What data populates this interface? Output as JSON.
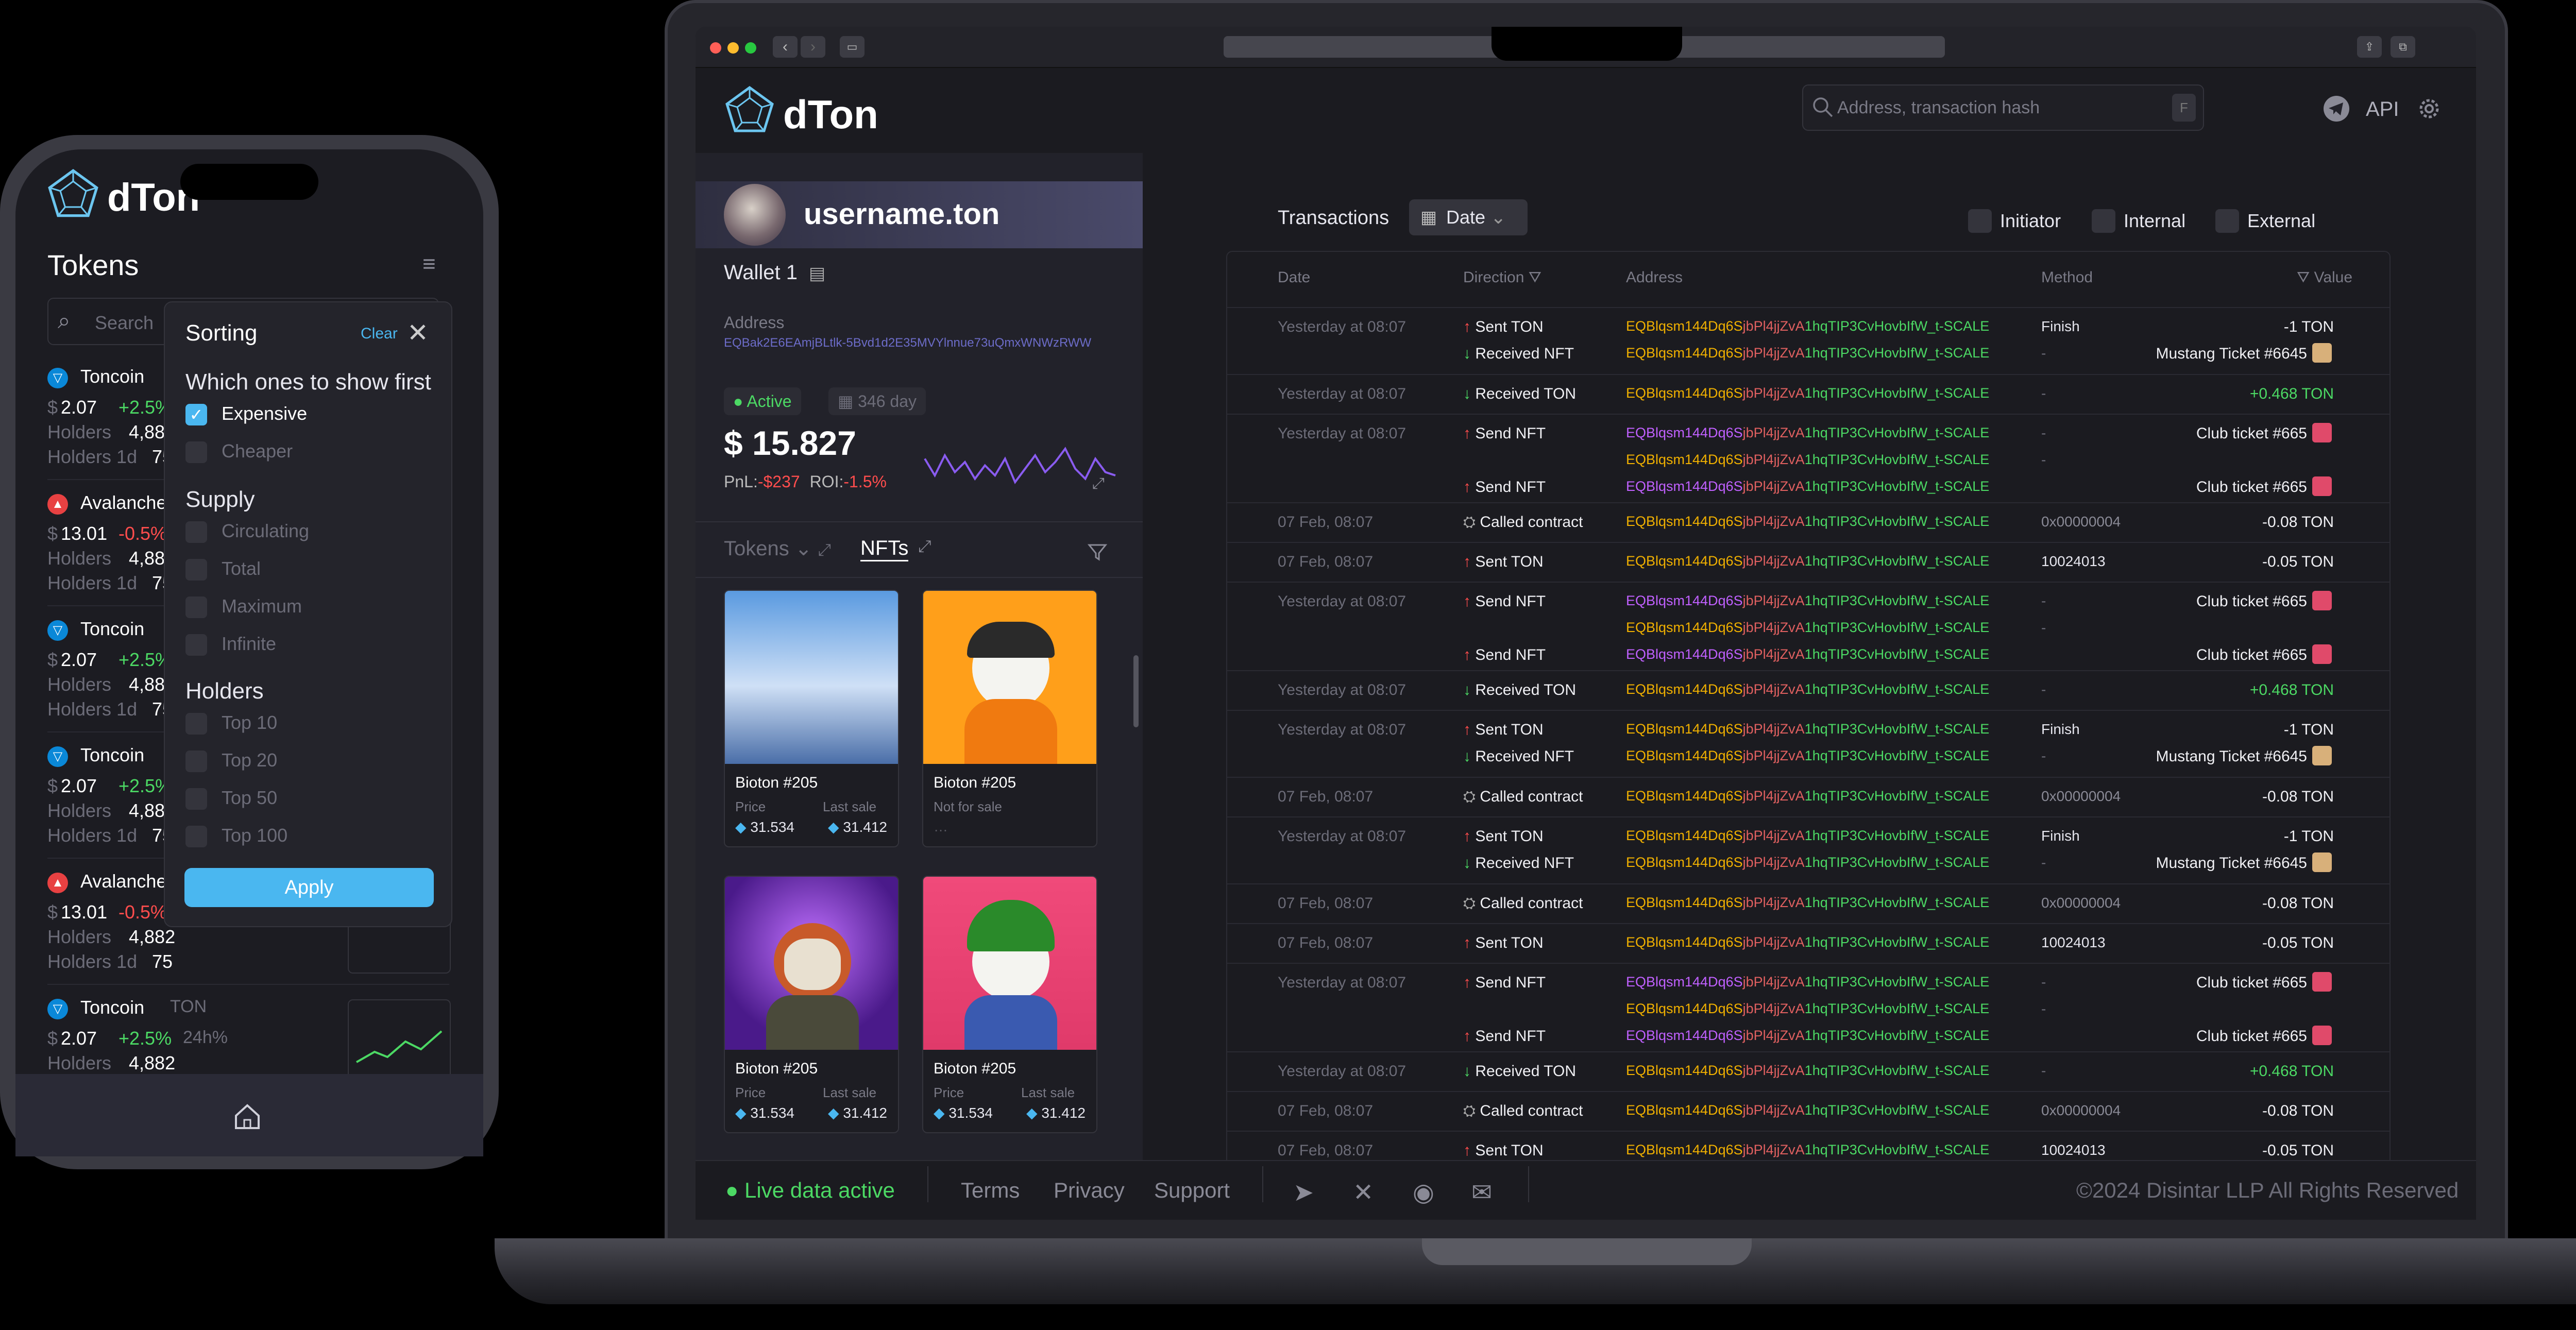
{
  "app": {
    "brand": "dTon"
  },
  "search": {
    "placeholder": "Address, transaction hash",
    "shortcut": "F"
  },
  "header": {
    "api_label": "API"
  },
  "profile": {
    "username": "username.ton",
    "wallet_label": "Wallet 1",
    "address_label": "Address",
    "address_value": "EQBak2E6EAmjBLtlk-5Bvd1d2E35MVYlnnue73uQmxWNWzRWW",
    "status": "Active",
    "age": "346 day",
    "balance": "$ 15.827",
    "pnl_label": "PnL:",
    "pnl_value": "-$237",
    "roi_label": "ROI:",
    "roi_value": "-1.5%",
    "sparkline": [
      0.55,
      0.3,
      0.6,
      0.35,
      0.5,
      0.25,
      0.45,
      0.3,
      0.55,
      0.2,
      0.4,
      0.6,
      0.35,
      0.5,
      0.7,
      0.4,
      0.25,
      0.55,
      0.35,
      0.3
    ]
  },
  "assets_tabs": {
    "tokens": "Tokens",
    "nfts": "NFTs"
  },
  "nfts": [
    {
      "name": "Bioton #205",
      "price_label": "Price",
      "price": "31.534",
      "last_label": "Last sale",
      "last": "31.412",
      "art": "city"
    },
    {
      "name": "Bioton #205",
      "price_label": "Not for sale",
      "price": "",
      "last_label": "",
      "last": "",
      "art": "cat-orange"
    },
    {
      "name": "Bioton #205",
      "price_label": "Price",
      "price": "31.534",
      "last_label": "Last sale",
      "last": "31.412",
      "art": "bear-purple"
    },
    {
      "name": "Bioton #205",
      "price_label": "Price",
      "price": "31.534",
      "last_label": "Last sale",
      "last": "31.412",
      "art": "cat-pink"
    }
  ],
  "transactions": {
    "title": "Transactions",
    "date_filter": "Date",
    "filters": [
      "Initiator",
      "Internal",
      "External"
    ],
    "columns": [
      "Date",
      "Direction",
      "Address",
      "Method",
      "Value"
    ],
    "address": "EQBlqsm144Dq6SjbPl4jjZvA1hqTIP3CvHovbIfW_t-SCALE",
    "rows": [
      {
        "date": "Yesterday at 08:07",
        "lines": [
          {
            "dir": "up",
            "label": "Sent TON",
            "method": "Finish",
            "value": "-1 TON",
            "vcolor": "#f0f0f4",
            "nft": false
          },
          {
            "dir": "dn",
            "label": "Received NFT",
            "method": "-",
            "value": "Mustang Ticket #6645",
            "vcolor": "#f0f0f4",
            "nft": true
          }
        ]
      },
      {
        "date": "Yesterday at 08:07",
        "lines": [
          {
            "dir": "dn",
            "label": "Received TON",
            "method": "-",
            "value": "+0.468 TON",
            "vcolor": "#4cd964",
            "nft": false
          }
        ]
      },
      {
        "date": "Yesterday at 08:07",
        "lines": [
          {
            "dir": "up",
            "label": "Send NFT",
            "method": "-",
            "value": "Club ticket #665",
            "vcolor": "#f0f0f4",
            "nft": true
          },
          {
            "dir": "",
            "label": "",
            "method": "-",
            "value": "",
            "vcolor": "#f0f0f4",
            "nft": false
          },
          {
            "dir": "up",
            "label": "Send NFT",
            "method": "",
            "value": "Club ticket #665",
            "vcolor": "#f0f0f4",
            "nft": true
          }
        ]
      },
      {
        "date": "07 Feb, 08:07",
        "lines": [
          {
            "dir": "ct",
            "label": "Called contract",
            "method": "0x00000004",
            "value": "-0.08 TON",
            "vcolor": "#f0f0f4",
            "nft": false
          }
        ]
      },
      {
        "date": "07 Feb, 08:07",
        "lines": [
          {
            "dir": "up",
            "label": "Sent TON",
            "method": "10024013",
            "value": "-0.05 TON",
            "vcolor": "#f0f0f4",
            "nft": false
          }
        ]
      },
      {
        "date": "Yesterday at 08:07",
        "lines": [
          {
            "dir": "up",
            "label": "Send NFT",
            "method": "-",
            "value": "Club ticket #665",
            "vcolor": "#f0f0f4",
            "nft": true
          },
          {
            "dir": "",
            "label": "",
            "method": "-",
            "value": "",
            "vcolor": "#f0f0f4",
            "nft": false
          },
          {
            "dir": "up",
            "label": "Send NFT",
            "method": "",
            "value": "Club ticket #665",
            "vcolor": "#f0f0f4",
            "nft": true
          }
        ]
      },
      {
        "date": "Yesterday at 08:07",
        "lines": [
          {
            "dir": "dn",
            "label": "Received TON",
            "method": "-",
            "value": "+0.468 TON",
            "vcolor": "#4cd964",
            "nft": false
          }
        ]
      },
      {
        "date": "Yesterday at 08:07",
        "lines": [
          {
            "dir": "up",
            "label": "Sent TON",
            "method": "Finish",
            "value": "-1 TON",
            "vcolor": "#f0f0f4",
            "nft": false
          },
          {
            "dir": "dn",
            "label": "Received NFT",
            "method": "-",
            "value": "Mustang Ticket #6645",
            "vcolor": "#f0f0f4",
            "nft": true
          }
        ]
      },
      {
        "date": "07 Feb, 08:07",
        "lines": [
          {
            "dir": "ct",
            "label": "Called contract",
            "method": "0x00000004",
            "value": "-0.08 TON",
            "vcolor": "#f0f0f4",
            "nft": false
          }
        ]
      },
      {
        "date": "Yesterday at 08:07",
        "lines": [
          {
            "dir": "up",
            "label": "Sent TON",
            "method": "Finish",
            "value": "-1 TON",
            "vcolor": "#f0f0f4",
            "nft": false
          },
          {
            "dir": "dn",
            "label": "Received NFT",
            "method": "-",
            "value": "Mustang Ticket #6645",
            "vcolor": "#f0f0f4",
            "nft": true
          }
        ]
      },
      {
        "date": "07 Feb, 08:07",
        "lines": [
          {
            "dir": "ct",
            "label": "Called contract",
            "method": "0x00000004",
            "value": "-0.08 TON",
            "vcolor": "#f0f0f4",
            "nft": false
          }
        ]
      },
      {
        "date": "07 Feb, 08:07",
        "lines": [
          {
            "dir": "up",
            "label": "Sent TON",
            "method": "10024013",
            "value": "-0.05 TON",
            "vcolor": "#f0f0f4",
            "nft": false
          }
        ]
      },
      {
        "date": "Yesterday at 08:07",
        "lines": [
          {
            "dir": "up",
            "label": "Send NFT",
            "method": "-",
            "value": "Club ticket #665",
            "vcolor": "#f0f0f4",
            "nft": true
          },
          {
            "dir": "",
            "label": "",
            "method": "-",
            "value": "",
            "vcolor": "#f0f0f4",
            "nft": false
          },
          {
            "dir": "up",
            "label": "Send NFT",
            "method": "",
            "value": "Club ticket #665",
            "vcolor": "#f0f0f4",
            "nft": true
          }
        ]
      },
      {
        "date": "Yesterday at 08:07",
        "lines": [
          {
            "dir": "dn",
            "label": "Received TON",
            "method": "-",
            "value": "+0.468 TON",
            "vcolor": "#4cd964",
            "nft": false
          }
        ]
      },
      {
        "date": "07 Feb, 08:07",
        "lines": [
          {
            "dir": "ct",
            "label": "Called contract",
            "method": "0x00000004",
            "value": "-0.08 TON",
            "vcolor": "#f0f0f4",
            "nft": false
          }
        ]
      },
      {
        "date": "07 Feb, 08:07",
        "lines": [
          {
            "dir": "up",
            "label": "Sent TON",
            "method": "10024013",
            "value": "-0.05 TON",
            "vcolor": "#f0f0f4",
            "nft": false
          }
        ]
      }
    ]
  },
  "footer": {
    "live": "Live data active",
    "links": [
      "Terms",
      "Privacy",
      "Support"
    ],
    "copyright": "©2024 Disintar LLP All Rights Reserved"
  },
  "phone": {
    "brand": "dTon",
    "title": "Tokens",
    "search_placeholder": "Search",
    "tokens": [
      {
        "name": "Toncoin",
        "price": "2.07",
        "change": "+2.5%",
        "holders": "4,882",
        "h1d": "75",
        "up": true
      },
      {
        "name": "Avalanche",
        "price": "13.01",
        "change": "-0.5%",
        "holders": "4,882",
        "h1d": "75",
        "up": false
      },
      {
        "name": "Toncoin",
        "price": "2.07",
        "change": "+2.5%",
        "holders": "4,882",
        "h1d": "75",
        "up": true
      },
      {
        "name": "Toncoin",
        "price": "2.07",
        "change": "+2.5%",
        "holders": "4,882",
        "h1d": "75",
        "up": true
      },
      {
        "name": "Avalanche",
        "price": "13.01",
        "change": "-0.5%",
        "holders": "4,882",
        "h1d": "75",
        "up": false
      },
      {
        "name": "Toncoin",
        "ticker": "TON",
        "price": "2.07",
        "change": "+2.5%",
        "period": "24h%",
        "holders": "4,882",
        "up": true
      }
    ],
    "labels": {
      "holders": "Holders",
      "holders_1d": "Holders 1d"
    },
    "sorting": {
      "title": "Sorting",
      "clear": "Clear",
      "first_heading": "Which ones to show first",
      "first_options": [
        "Expensive",
        "Cheaper"
      ],
      "supply_heading": "Supply",
      "supply_options": [
        "Circulating",
        "Total",
        "Maximum",
        "Infinite"
      ],
      "holders_heading": "Holders",
      "holders_options": [
        "Top 10",
        "Top 20",
        "Top 50",
        "Top 100"
      ],
      "apply": "Apply"
    }
  },
  "colors": {
    "accent": "#4ab7f0",
    "positive": "#4cd964",
    "negative": "#ff4d4d",
    "sparkline": "#8a5cf0"
  }
}
